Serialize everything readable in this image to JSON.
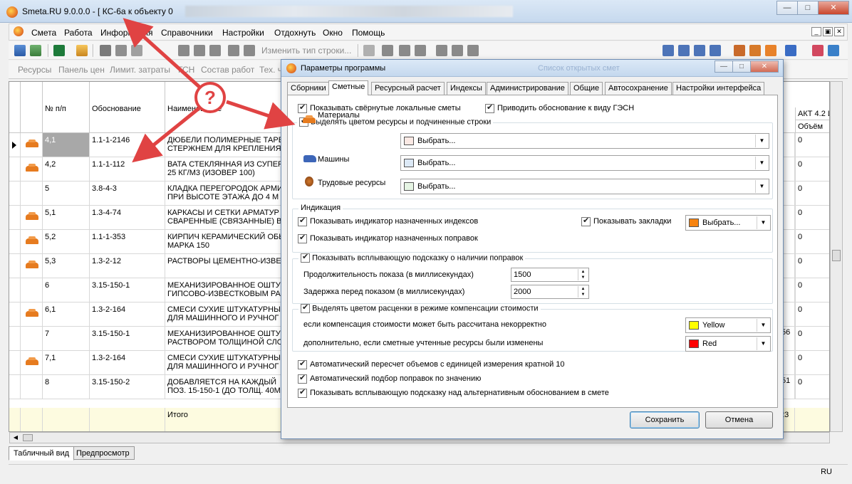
{
  "window": {
    "title": "Smeta.RU  9.0.0.0   - [ КС-6а к объекту 0",
    "controls": [
      "—",
      "□",
      "✕"
    ]
  },
  "menu": {
    "items": [
      "Смета",
      "Работа",
      "Информация",
      "Справочники",
      "Настройки",
      "Отдохнуть",
      "Окно",
      "Помощь"
    ]
  },
  "toolbar1": {
    "change_row_type": "Изменить тип строки..."
  },
  "toolbar2": {
    "items": [
      "Ресурсы",
      "Панель цен",
      "Лимит. затраты",
      "ГСН",
      "Состав работ",
      "Тех. ч"
    ]
  },
  "grid": {
    "headers": {
      "num": "№ п/п",
      "basis": "Обоснование",
      "name": "Наименование",
      "act": "АКТ 4.2 И",
      "volume": "Объём"
    },
    "rows": [
      {
        "num": "4,1",
        "basis": "1.1-1-2146",
        "name1": "ДЮБЕЛИ ПОЛИМЕРНЫЕ ТАРЕ",
        "name2": "СТЕРЖНЕМ ДЛЯ КРЕПЛЕНИЯ",
        "vol": "0"
      },
      {
        "num": "4,2",
        "basis": "1.1-1-112",
        "name1": "ВАТА СТЕКЛЯННАЯ ИЗ СУПЕР",
        "name2": "25 КГ/М3 (Изовер 100)",
        "vol": "0"
      },
      {
        "num": "5",
        "basis": "3.8-4-3",
        "name1": "КЛАДКА ПЕРЕГОРОДОК АРМИ",
        "name2": "ПРИ ВЫСОТЕ ЭТАЖА ДО 4 М",
        "vol": "0"
      },
      {
        "num": "5,1",
        "basis": "1.3-4-74",
        "name1": "КАРКАСЫ И СЕТКИ АРМАТУР",
        "name2": "СВАРЕННЫЕ (СВЯЗАННЫЕ) В",
        "vol": "0"
      },
      {
        "num": "5,2",
        "basis": "1.1-1-353",
        "name1": "КИРПИЧ КЕРАМИЧЕСКИЙ ОБЬ",
        "name2": "МАРКА 150",
        "vol": "0"
      },
      {
        "num": "5,3",
        "basis": "1.3-2-12",
        "name1": "РАСТВОРЫ ЦЕМЕНТНО-ИЗВЕС",
        "name2": "",
        "vol": "0"
      },
      {
        "num": "6",
        "basis": "3.15-150-1",
        "name1": "МЕХАНИЗИРОВАННОЕ ОШТУК",
        "name2": "ГИПСОВО-ИЗВЕСТКОВЫМ РАС",
        "vol": "0"
      },
      {
        "num": "6,1",
        "basis": "1.3-2-164",
        "name1": "СМЕСИ СУХИЕ ШТУКАТУРНЫ",
        "name2": "ДЛЯ МАШИННОГО И РУЧНОГ",
        "vol": "0"
      },
      {
        "num": "7",
        "basis": "3.15-150-1",
        "name1": "МЕХАНИЗИРОВАННОЕ ОШТУК",
        "name2": "РАСТВОРОМ ТОЛЩИНОЙ СЛО",
        "vol": "0"
      },
      {
        "num": "7,1",
        "basis": "1.3-2-164",
        "name1": "СМЕСИ СУХИЕ ШТУКАТУРНЫ",
        "name2": "ДЛЯ МАШИННОГО И РУЧНОГ",
        "vol": "0"
      },
      {
        "num": "8",
        "basis": "3.15-150-2",
        "name1": "ДОБАВЛЯЕТСЯ НА КАЖДЫЙ",
        "name2": "ПОЗ. 15-150-1 (до толщ. 40мм)",
        "vol": "0"
      }
    ],
    "side_fragments": [
      "56",
      "51"
    ],
    "total_label": "Итого",
    "total_fragment": "23"
  },
  "bottom_tabs": [
    "Табличный вид",
    "Предпросмотр"
  ],
  "status": {
    "lang": "RU"
  },
  "dialog": {
    "title": "Параметры программы",
    "title_ghost": "Список открытых смет",
    "tabs": [
      "Сборники",
      "Сметные",
      "Ресурсный расчет",
      "Индексы",
      "Администрирование",
      "Общие",
      "Автосохранение",
      "Настройки интерфейса"
    ],
    "active_tab": "Сметные",
    "show_collapsed": "Показывать свёрнутые локальные сметы",
    "bring_basis": "Приводить обоснование к виду ГЭСН",
    "highlight_resources": "Выделять цветом ресурсы и подчиненные строки",
    "materials": "Материалы",
    "machines": "Машины",
    "labor": "Трудовые ресурсы",
    "choose": "Выбрать...",
    "material_color": "#fbe9e4",
    "machine_color": "#dce9f6",
    "labor_color": "#e6f5e4",
    "indication_group": "Индикация",
    "show_index_indicator": "Показывать индикатор назначенных индексов",
    "show_bookmarks": "Показывать закладки",
    "bookmark_color": "#f7830f",
    "show_corrections_indicator": "Показывать индикатор назначенных поправок",
    "show_tooltip_corrections": "Показывать всплывающую подсказку о наличии поправок",
    "duration_label": "Продолжительность показа (в миллисекундах)",
    "duration_value": "1500",
    "delay_label": "Задержка перед показом (в миллисекундах)",
    "delay_value": "2000",
    "highlight_compensation": "Выделять цветом расценки в режиме компенсации стоимости",
    "compensation_incorrect": "если компенсация стоимости может быть рассчитана некорректно",
    "compensation_incorrect_color_name": "Yellow",
    "compensation_incorrect_color": "#ffff00",
    "compensation_changed": "дополнительно, если сметные учтенные ресурсы были изменены",
    "compensation_changed_color_name": "Red",
    "compensation_changed_color": "#ff0000",
    "auto_recalc": "Автоматический пересчет объемов с единицей измерения кратной 10",
    "auto_select": "Автоматический подбор поправок по значению",
    "show_alt_tooltip": "Показывать всплывающую подсказку над альтернативным обоснованием в смете",
    "save": "Сохранить",
    "cancel": "Отмена"
  },
  "annotation": {
    "symbol": "?",
    "color": "#e04343"
  }
}
